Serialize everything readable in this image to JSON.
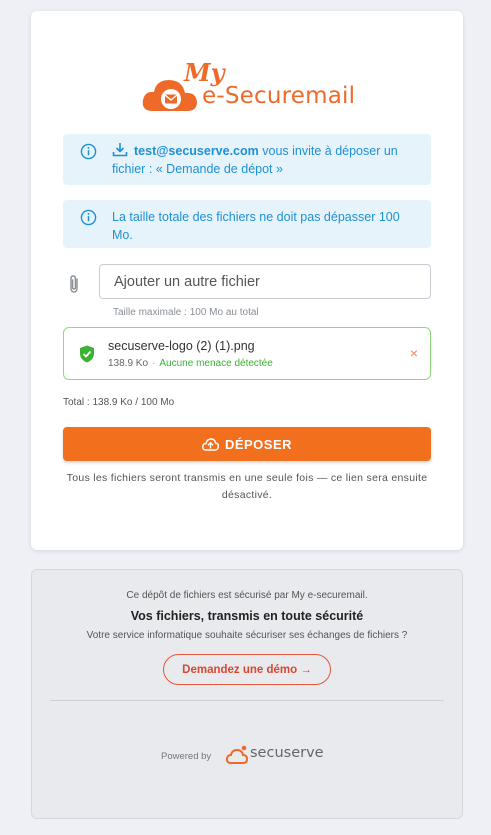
{
  "brand": {
    "logo_my": "My",
    "logo_text": "e-Securemail",
    "accent_color": "#f26f1e"
  },
  "invite": {
    "email": "test@secuserve.com",
    "text": " vous invite à déposer un fichier : « Demande de dépot »",
    "icon": "info-icon",
    "download_icon": "download-icon"
  },
  "size_notice": {
    "text": "La taille totale des fichiers ne doit pas dépasser 100 Mo.",
    "icon": "info-icon"
  },
  "file_input": {
    "placeholder": "Ajouter un autre fichier",
    "max_size": "Taille maximale : 100 Mo au total"
  },
  "file": {
    "name": "secuserve-logo (2) (1).png",
    "size": "138.9 Ko",
    "separator": "·",
    "status": "Aucune menace détectée",
    "status_color": "#3bb232",
    "remove": "×"
  },
  "total": "Total : 138.9 Ko / 100 Mo",
  "submit_label": "DÉPOSER",
  "notice": "Tous les fichiers seront transmis en une seule fois — ce lien sera ensuite désactivé.",
  "footer": {
    "line1": "Ce dépôt de fichiers est sécurisé par My e-securemail.",
    "line2": "Vos fichiers, transmis en toute sécurité",
    "line3": "Votre service informatique souhaite sécuriser ses échanges de fichiers ?",
    "demo_label": "Demandez une démo →",
    "powered_by": "Powered by",
    "partner": "secuserve"
  }
}
